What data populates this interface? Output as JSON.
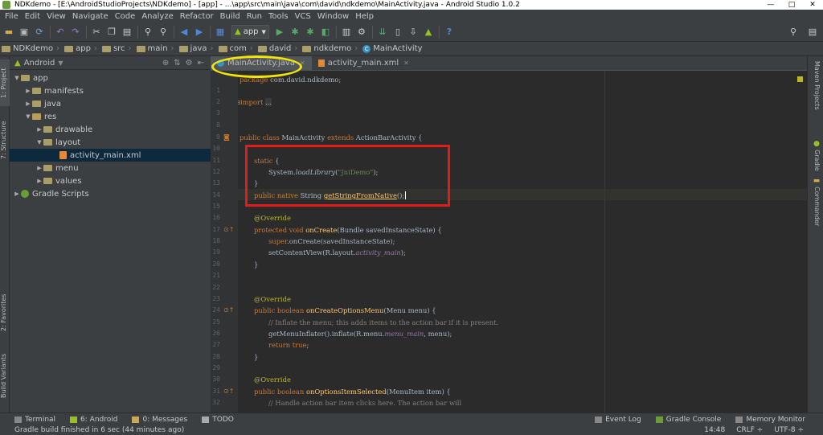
{
  "window": {
    "title": "NDKdemo - [E:\\AndroidStudioProjects\\NDKdemo] - [app] - ...\\app\\src\\main\\java\\com\\david\\ndkdemo\\MainActivity.java - Android Studio 1.0.2",
    "minimize": "—",
    "maximize": "□",
    "close": "✕"
  },
  "menu": [
    "File",
    "Edit",
    "View",
    "Navigate",
    "Code",
    "Analyze",
    "Refactor",
    "Build",
    "Run",
    "Tools",
    "VCS",
    "Window",
    "Help"
  ],
  "toolbar": {
    "run_config": "app",
    "help": "?"
  },
  "breadcrumbs": [
    "NDKdemo",
    "app",
    "src",
    "main",
    "java",
    "com",
    "david",
    "ndkdemo",
    "MainActivity"
  ],
  "project_panel": {
    "view": "Android",
    "tree": [
      {
        "label": "app",
        "level": 0,
        "expanded": true
      },
      {
        "label": "manifests",
        "level": 1,
        "expanded": false
      },
      {
        "label": "java",
        "level": 1,
        "expanded": false
      },
      {
        "label": "res",
        "level": 1,
        "expanded": true
      },
      {
        "label": "drawable",
        "level": 2,
        "expanded": false
      },
      {
        "label": "layout",
        "level": 2,
        "expanded": true
      },
      {
        "label": "activity_main.xml",
        "level": 3,
        "selected": true
      },
      {
        "label": "menu",
        "level": 2,
        "expanded": false
      },
      {
        "label": "values",
        "level": 2,
        "expanded": false
      },
      {
        "label": "Gradle Scripts",
        "level": 0,
        "expanded": false
      }
    ]
  },
  "left_tool_tabs": [
    "1: Project",
    "7: Structure",
    "2: Favorites",
    "Build Variants"
  ],
  "right_tool_tabs": [
    "Maven Projects",
    "Gradle",
    "Commander"
  ],
  "editor_tabs": [
    {
      "label": "MainActivity.java",
      "active": true
    },
    {
      "label": "activity_main.xml",
      "active": false
    }
  ],
  "code": {
    "line_numbers": [
      "",
      "1",
      "2",
      "3",
      "8",
      "9",
      "10",
      "11",
      "12",
      "13",
      "14",
      "15",
      "16",
      "17",
      "18",
      "19",
      "20",
      "21",
      "22",
      "23",
      "24",
      "25",
      "26",
      "27",
      "28",
      "29",
      "30",
      "31",
      "32"
    ]
  },
  "bottom_tools": [
    "Terminal",
    "6: Android",
    "0: Messages",
    "TODO"
  ],
  "bottom_tools_right": [
    "Event Log",
    "Gradle Console",
    "Memory Monitor"
  ],
  "status": {
    "message": "Gradle build finished in 6 sec (44 minutes ago)",
    "position": "14:48",
    "line_sep": "CRLF ÷",
    "encoding": "UTF-8 ÷"
  }
}
